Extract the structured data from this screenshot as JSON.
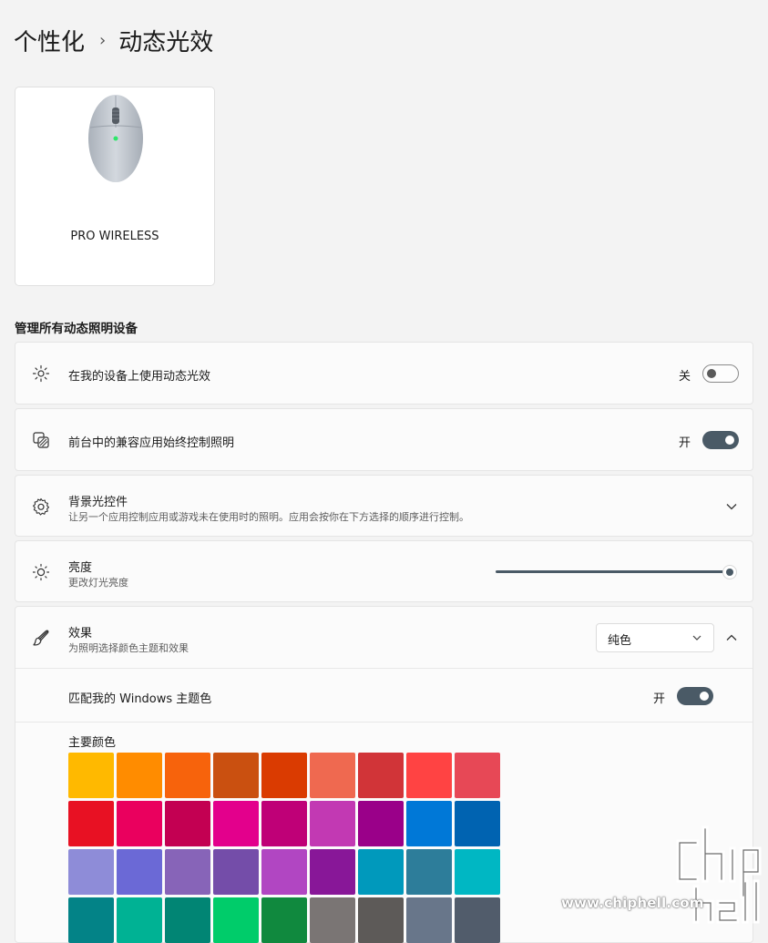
{
  "breadcrumb": {
    "parent": "个性化",
    "separator": "›",
    "current": "动态光效"
  },
  "device": {
    "name": "PRO WIRELESS"
  },
  "section_title": "管理所有动态照明设备",
  "rows": {
    "use_lighting": {
      "title": "在我的设备上使用动态光效",
      "toggle_label": "关",
      "toggle_on": false,
      "icon": "lighting-icon"
    },
    "foreground": {
      "title": "前台中的兼容应用始终控制照明",
      "toggle_label": "开",
      "toggle_on": true,
      "icon": "layers-icon"
    },
    "background": {
      "title": "背景光控件",
      "subtitle": "让另一个应用控制应用或游戏未在使用时的照明。应用会按你在下方选择的顺序进行控制。",
      "icon": "gear-icon"
    },
    "brightness": {
      "title": "亮度",
      "subtitle": "更改灯光亮度",
      "value_percent": 100,
      "icon": "sun-icon"
    },
    "effects": {
      "title": "效果",
      "subtitle": "为照明选择颜色主题和效果",
      "selected": "纯色",
      "icon": "brush-icon"
    }
  },
  "match_theme": {
    "label": "匹配我的 Windows 主题色",
    "toggle_label": "开",
    "toggle_on": true
  },
  "main_colors": {
    "title": "主要颜色",
    "swatches": [
      "#ffb900",
      "#ff8c00",
      "#f7630c",
      "#ca5010",
      "#da3b01",
      "#ef6950",
      "#d13438",
      "#ff4343",
      "#e74856",
      "#e81123",
      "#ea005e",
      "#c30052",
      "#e3008c",
      "#bf0077",
      "#c239b3",
      "#9a0089",
      "#0078d7",
      "#0063b1",
      "#8e8cd8",
      "#6b69d6",
      "#8764b8",
      "#744da9",
      "#b146c2",
      "#881798",
      "#0099bc",
      "#2d7d9a",
      "#00b7c3",
      "#038387",
      "#00b294",
      "#018574",
      "#00cc6a",
      "#10893e",
      "#7a7574",
      "#5d5a58",
      "#68768a",
      "#515c6b"
    ]
  },
  "watermark": {
    "text": "www.chiphell.com"
  },
  "colors": {
    "accent": "#4a5a66",
    "background": "#f3f3f3",
    "card": "#fbfbfb"
  }
}
